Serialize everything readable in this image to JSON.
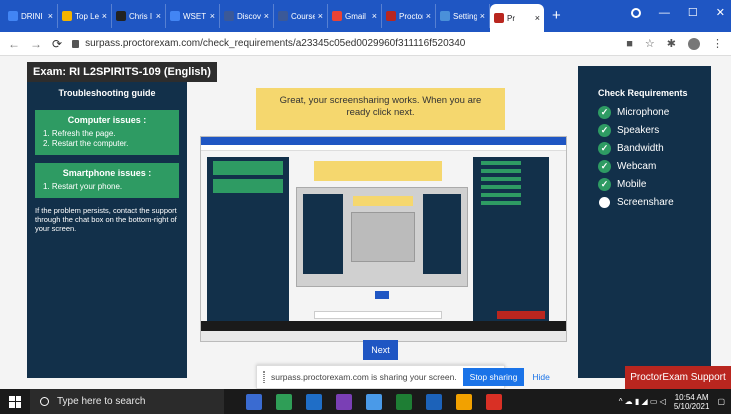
{
  "browser": {
    "tabs": [
      {
        "label": "DRINI",
        "color": "#4285f4"
      },
      {
        "label": "Top Le",
        "color": "#f4b400"
      },
      {
        "label": "Chris I",
        "color": "#222222"
      },
      {
        "label": "WSET",
        "color": "#4285f4"
      },
      {
        "label": "Discov",
        "color": "#3b5998"
      },
      {
        "label": "Course",
        "color": "#3b5998"
      },
      {
        "label": "Gmail",
        "color": "#ea4335"
      },
      {
        "label": "Proctor",
        "color": "#b9261f"
      },
      {
        "label": "Setting",
        "color": "#4a90d9"
      },
      {
        "label": "Pr",
        "color": "#b9261f"
      }
    ],
    "close_glyph": "×",
    "new_tab": "+",
    "url": "surpass.proctorexam.com/check_requirements/a23345c05ed0029960f311116f520340"
  },
  "exam": {
    "title": "Exam: RI L2SPIRITS-109 (English)"
  },
  "troubleshooting": {
    "heading": "Troubleshooting guide",
    "computer": {
      "title": "Computer issues :",
      "steps": [
        "1. Refresh the page.",
        "2. Restart the computer."
      ]
    },
    "smartphone": {
      "title": "Smartphone issues :",
      "steps": [
        "1. Restart your phone."
      ]
    },
    "help_text": "If the problem persists, contact the support through the chat box on the bottom-right of your screen."
  },
  "banner": {
    "text": "Great, your screensharing works. When you are ready click next."
  },
  "next_button": "Next",
  "requirements": {
    "heading": "Check Requirements",
    "items": [
      {
        "label": "Microphone",
        "status": "ok"
      },
      {
        "label": "Speakers",
        "status": "ok"
      },
      {
        "label": "Bandwidth",
        "status": "ok"
      },
      {
        "label": "Webcam",
        "status": "ok"
      },
      {
        "label": "Mobile",
        "status": "ok"
      },
      {
        "label": "Screenshare",
        "status": "pending"
      }
    ],
    "check_glyph": "✓"
  },
  "sharebar": {
    "text": "surpass.proctorexam.com is sharing your screen.",
    "stop": "Stop sharing",
    "hide": "Hide"
  },
  "support": "ProctorExam Support",
  "taskbar": {
    "search_placeholder": "Type here to search",
    "time": "10:54 AM",
    "date": "5/10/2021",
    "apps": [
      "#3a6bd1",
      "#2f9e57",
      "#1f6ec7",
      "#7a3fb5",
      "#4a9ae8",
      "#1e7e34",
      "#1c62b9",
      "#f2a100",
      "#d93025"
    ]
  },
  "colors": {
    "panel": "#12304a",
    "green": "#2e9b63",
    "banner": "#f5d76e",
    "accent": "#1f56c3",
    "support": "#b9261f"
  }
}
